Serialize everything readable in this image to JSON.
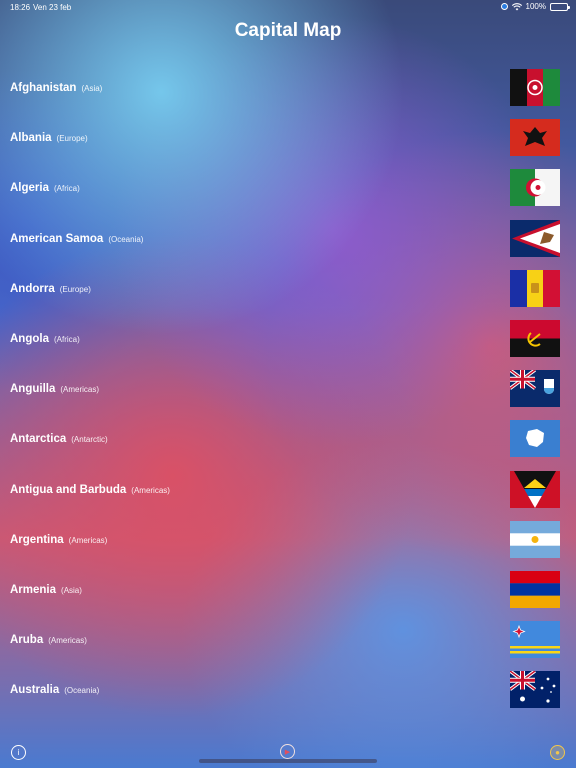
{
  "status": {
    "time": "18:26",
    "date": "Ven 23 feb",
    "battery": "100%",
    "battery_level": 1.0
  },
  "header": {
    "title": "Capital Map"
  },
  "countries": [
    {
      "name": "Afghanistan",
      "continent": "(Asia)",
      "flag_icon": "afghanistan-flag-icon"
    },
    {
      "name": "Albania",
      "continent": "(Europe)",
      "flag_icon": "albania-flag-icon"
    },
    {
      "name": "Algeria",
      "continent": "(Africa)",
      "flag_icon": "algeria-flag-icon"
    },
    {
      "name": "American Samoa",
      "continent": "(Oceania)",
      "flag_icon": "american-samoa-flag-icon"
    },
    {
      "name": "Andorra",
      "continent": "(Europe)",
      "flag_icon": "andorra-flag-icon"
    },
    {
      "name": "Angola",
      "continent": "(Africa)",
      "flag_icon": "angola-flag-icon"
    },
    {
      "name": "Anguilla",
      "continent": "(Americas)",
      "flag_icon": "anguilla-flag-icon"
    },
    {
      "name": "Antarctica",
      "continent": "(Antarctic)",
      "flag_icon": "antarctica-flag-icon"
    },
    {
      "name": "Antigua and Barbuda",
      "continent": "(Americas)",
      "flag_icon": "antigua-flag-icon"
    },
    {
      "name": "Argentina",
      "continent": "(Americas)",
      "flag_icon": "argentina-flag-icon"
    },
    {
      "name": "Armenia",
      "continent": "(Asia)",
      "flag_icon": "armenia-flag-icon"
    },
    {
      "name": "Aruba",
      "continent": "(Americas)",
      "flag_icon": "aruba-flag-icon"
    },
    {
      "name": "Australia",
      "continent": "(Oceania)",
      "flag_icon": "australia-flag-icon"
    }
  ],
  "bottom_bar": {
    "info_icon": "info-icon",
    "play_icon": "play-icon",
    "coin_icon": "coin-icon"
  }
}
